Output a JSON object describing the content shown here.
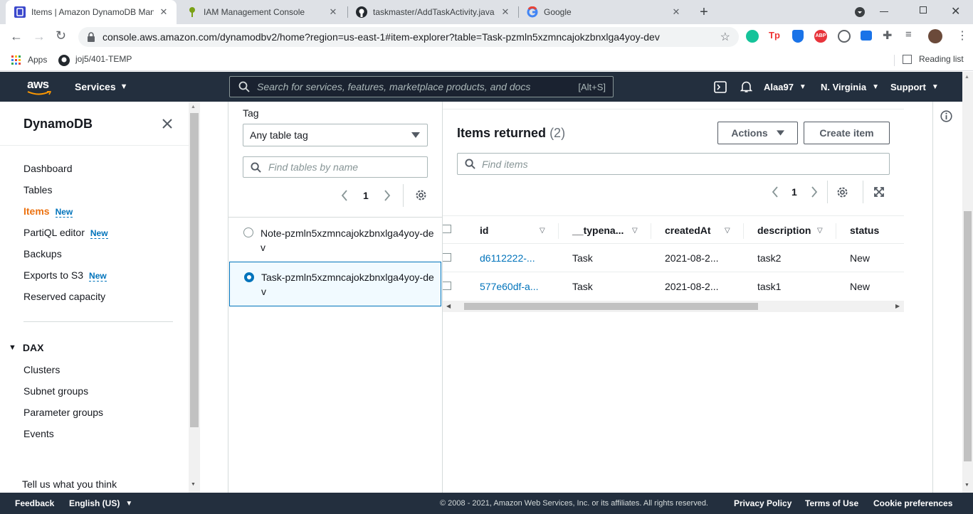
{
  "browser": {
    "tabs": [
      {
        "title": "Items | Amazon DynamoDB Mana",
        "active": true
      },
      {
        "title": "IAM Management Console",
        "active": false
      },
      {
        "title": "taskmaster/AddTaskActivity.java a",
        "active": false
      },
      {
        "title": "Google",
        "active": false
      }
    ],
    "url": "console.aws.amazon.com/dynamodbv2/home?region=us-east-1#item-explorer?table=Task-pzmln5xzmncajokzbnxlga4yoy-dev",
    "bookmarks": {
      "apps": "Apps",
      "repo": "joj5/401-TEMP",
      "reading_list": "Reading list"
    }
  },
  "awsnav": {
    "logo": "aws",
    "services": "Services",
    "search_placeholder": "Search for services, features, marketplace products, and docs",
    "search_shortcut": "[Alt+S]",
    "user": "Alaa97",
    "region": "N. Virginia",
    "support": "Support"
  },
  "sidenav": {
    "title": "DynamoDB",
    "items": [
      {
        "label": "Dashboard"
      },
      {
        "label": "Tables"
      },
      {
        "label": "Items",
        "badge": "New",
        "active": true
      },
      {
        "label": "PartiQL editor",
        "badge": "New"
      },
      {
        "label": "Backups"
      },
      {
        "label": "Exports to S3",
        "badge": "New"
      },
      {
        "label": "Reserved capacity"
      }
    ],
    "dax_title": "DAX",
    "dax_items": [
      "Clusters",
      "Subnet groups",
      "Parameter groups",
      "Events"
    ],
    "feedback_link": "Tell us what you think"
  },
  "tables_panel": {
    "tag_label": "Tag",
    "tag_value": "Any table tag",
    "find_placeholder": "Find tables by name",
    "page": "1",
    "tables": [
      {
        "name": "Note-pzmln5xzmncajokzbnxlga4yoy-dev",
        "selected": false
      },
      {
        "name": "Task-pzmln5xzmncajokzbnxlga4yoy-dev",
        "selected": true
      }
    ]
  },
  "items_panel": {
    "title": "Items returned",
    "count": "(2)",
    "actions_label": "Actions",
    "create_label": "Create item",
    "find_placeholder": "Find items",
    "page": "1",
    "columns": [
      "id",
      "__typena...",
      "createdAt",
      "description",
      "status"
    ],
    "rows": [
      [
        "d6112222-...",
        "Task",
        "2021-08-2...",
        "task2",
        "New"
      ],
      [
        "577e60df-a...",
        "Task",
        "2021-08-2...",
        "task1",
        "New"
      ]
    ]
  },
  "footer": {
    "feedback": "Feedback",
    "language": "English (US)",
    "copyright": "© 2008 - 2021, Amazon Web Services, Inc. or its affiliates. All rights reserved.",
    "privacy": "Privacy Policy",
    "terms": "Terms of Use",
    "cookies": "Cookie preferences"
  },
  "colors": {
    "aws_nav": "#232f3e",
    "accent": "#ec7211",
    "link": "#0073bb"
  }
}
